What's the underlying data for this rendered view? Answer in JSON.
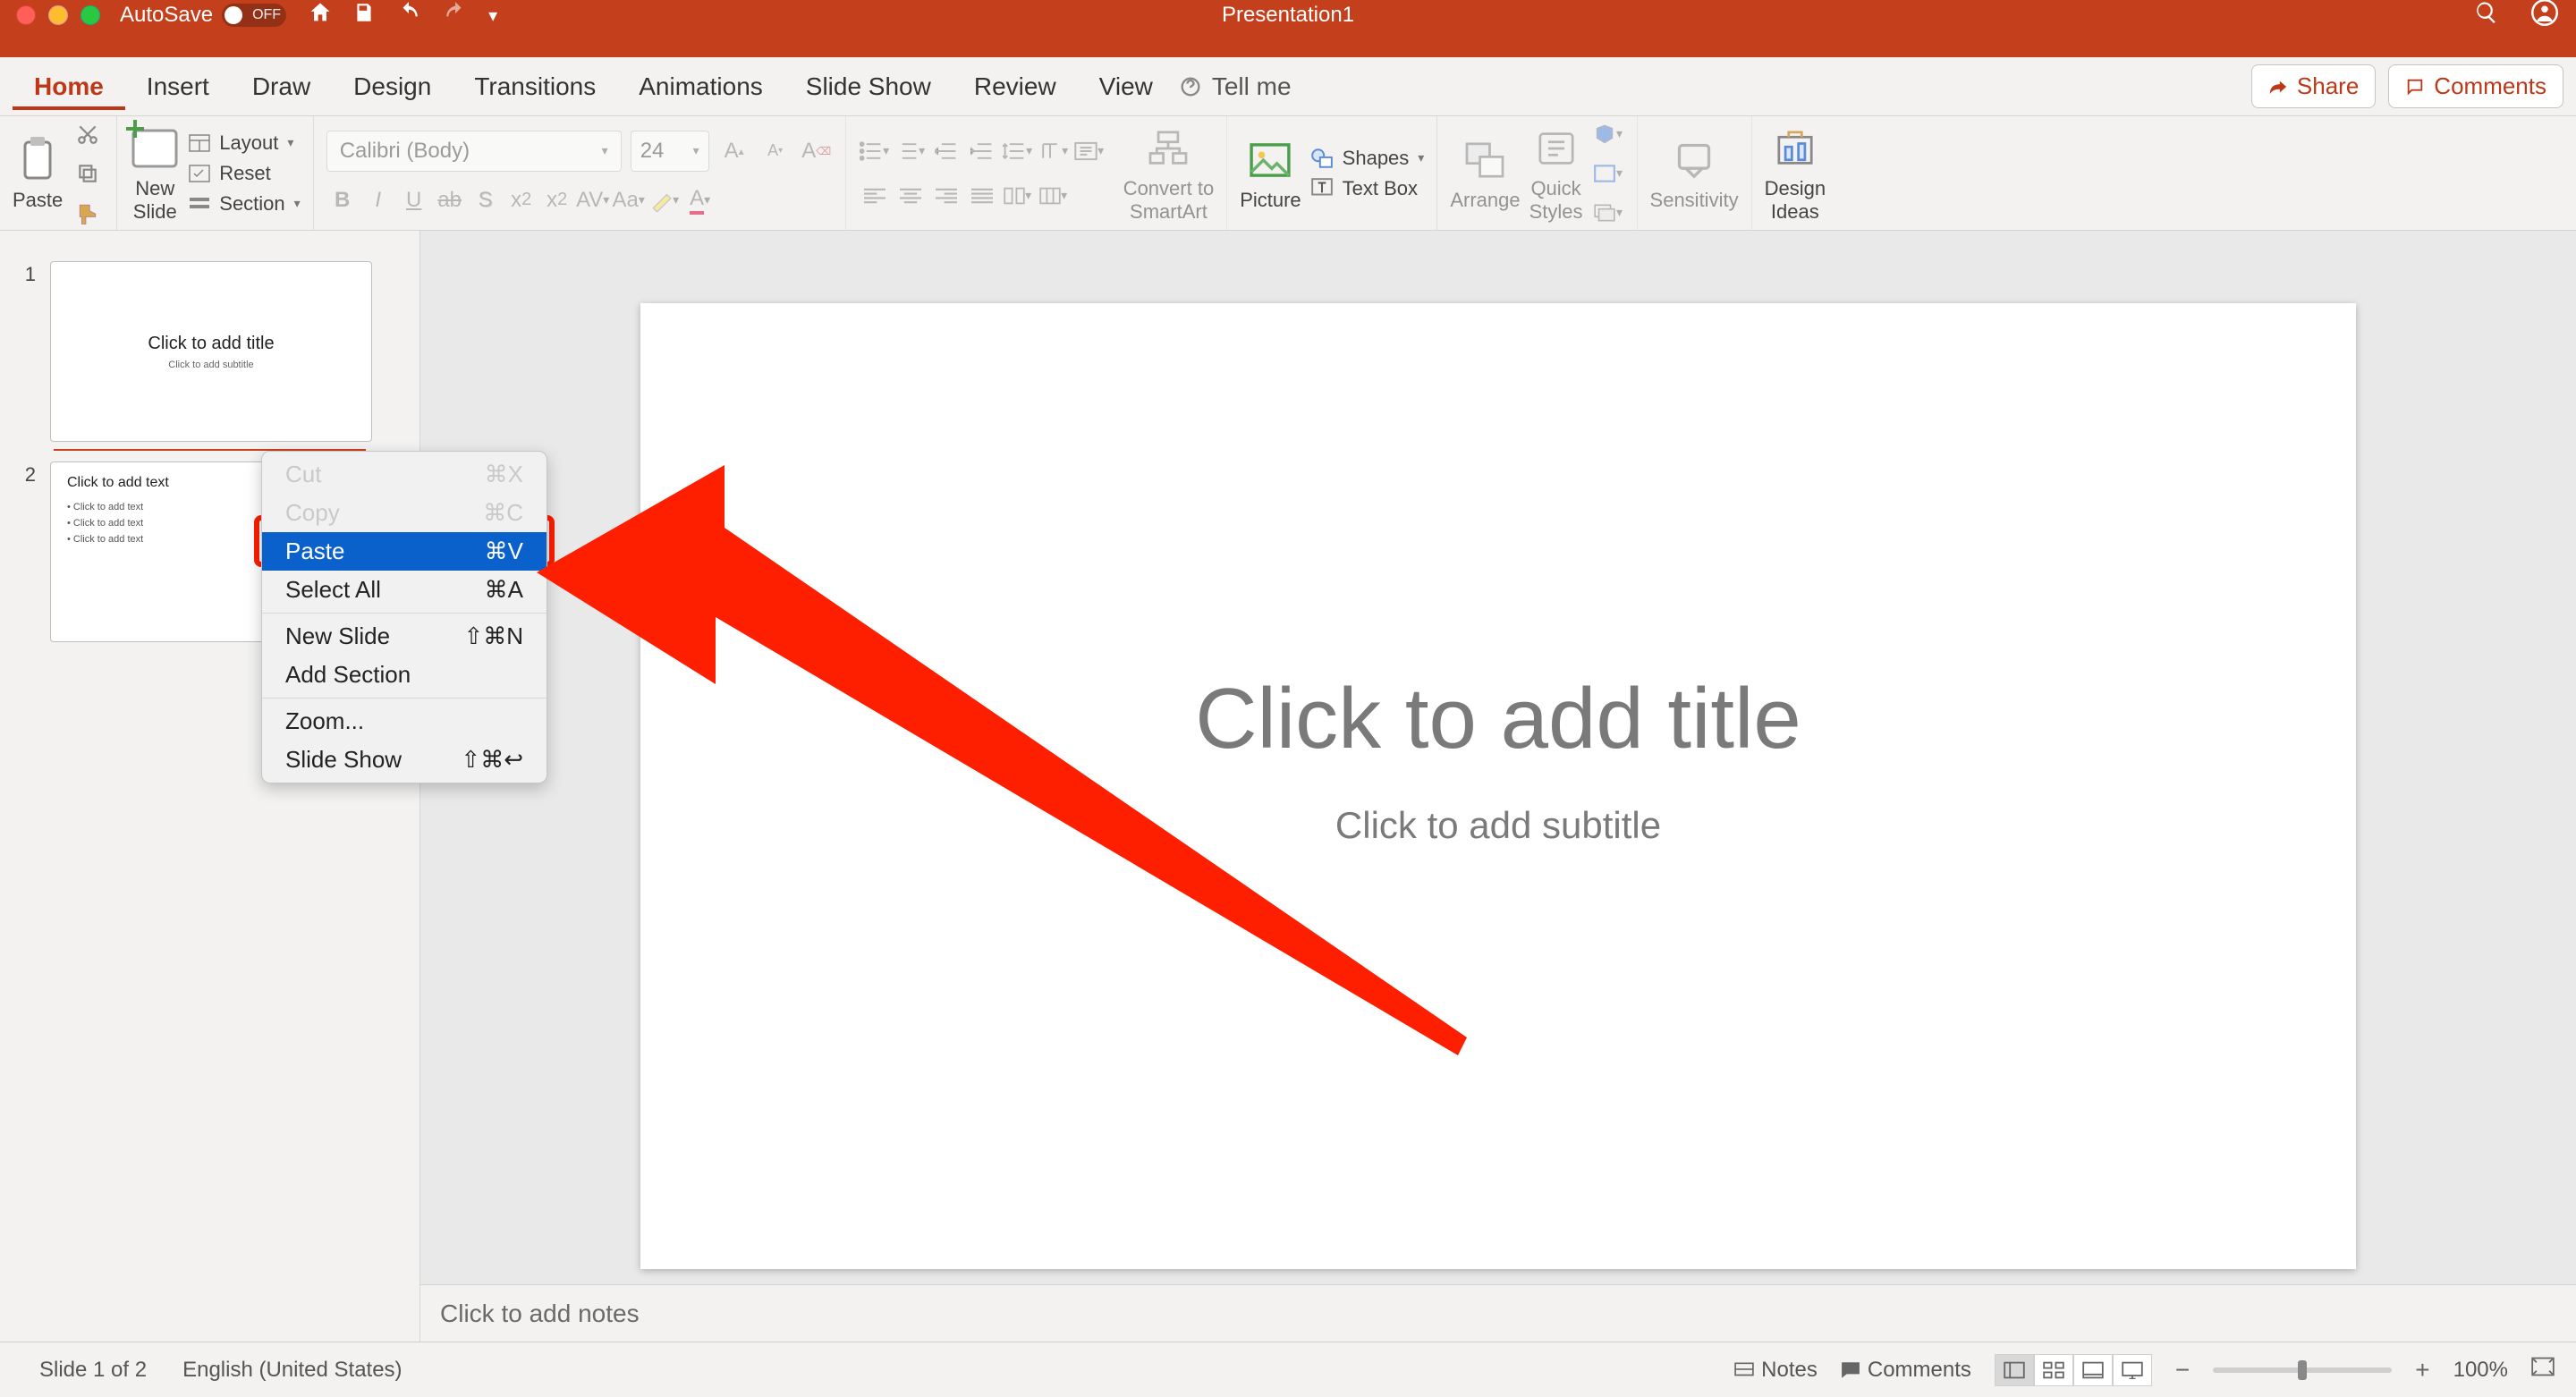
{
  "titlebar": {
    "autosave_label": "AutoSave",
    "autosave_state": "OFF",
    "doc_title": "Presentation1"
  },
  "tabs": {
    "items": [
      "Home",
      "Insert",
      "Draw",
      "Design",
      "Transitions",
      "Animations",
      "Slide Show",
      "Review",
      "View"
    ],
    "active": "Home",
    "tell_me": "Tell me",
    "share": "Share",
    "comments": "Comments"
  },
  "ribbon": {
    "paste": "Paste",
    "new_slide": "New\nSlide",
    "layout": "Layout",
    "reset": "Reset",
    "section": "Section",
    "font_name": "Calibri (Body)",
    "font_size": "24",
    "convert_smartart": "Convert to\nSmartArt",
    "picture": "Picture",
    "shapes": "Shapes",
    "text_box": "Text Box",
    "arrange": "Arrange",
    "quick_styles": "Quick\nStyles",
    "sensitivity": "Sensitivity",
    "design_ideas": "Design\nIdeas"
  },
  "thumbnails": {
    "slides": [
      {
        "num": "1",
        "title": "Click to add title",
        "sub": "Click to add subtitle"
      },
      {
        "num": "2",
        "header": "Click to add text",
        "bullets": [
          "Click to add text",
          "Click to add text",
          "Click to add text"
        ]
      }
    ]
  },
  "context_menu": {
    "items": [
      {
        "label": "Cut",
        "shortcut": "⌘X",
        "disabled": true
      },
      {
        "label": "Copy",
        "shortcut": "⌘C",
        "disabled": true
      },
      {
        "label": "Paste",
        "shortcut": "⌘V",
        "highlight": true
      },
      {
        "label": "Select All",
        "shortcut": "⌘A"
      },
      {
        "sep": true
      },
      {
        "label": "New Slide",
        "shortcut": "⇧⌘N"
      },
      {
        "label": "Add Section",
        "shortcut": ""
      },
      {
        "sep": true
      },
      {
        "label": "Zoom...",
        "shortcut": ""
      },
      {
        "label": "Slide Show",
        "shortcut": "⇧⌘↩"
      }
    ]
  },
  "canvas": {
    "title_placeholder": "Click to add title",
    "subtitle_placeholder": "Click to add subtitle"
  },
  "notes": {
    "placeholder": "Click to add notes"
  },
  "status": {
    "slide_counter": "Slide 1 of 2",
    "language": "English (United States)",
    "notes": "Notes",
    "comments": "Comments",
    "zoom": "100%"
  }
}
